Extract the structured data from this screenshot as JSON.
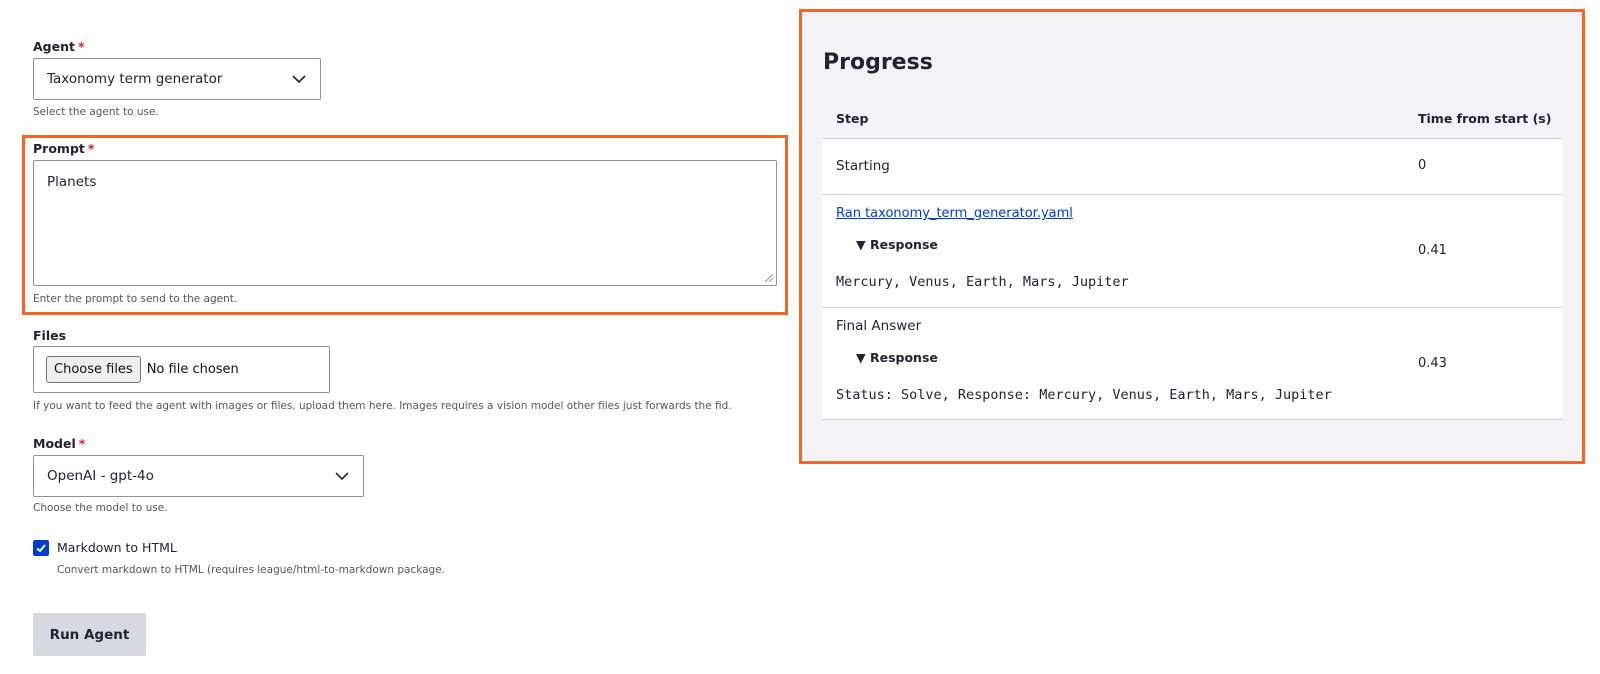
{
  "form": {
    "agent": {
      "label": "Agent",
      "required": "*",
      "value": "Taxonomy term generator",
      "description": "Select the agent to use."
    },
    "prompt": {
      "label": "Prompt",
      "required": "*",
      "value": "Planets",
      "description": "Enter the prompt to send to the agent."
    },
    "files": {
      "label": "Files",
      "button": "Choose files",
      "status": "No file chosen",
      "description": "If you want to feed the agent with images or files, upload them here. Images requires a vision model other files just forwards the fid."
    },
    "model": {
      "label": "Model",
      "required": "*",
      "value": "OpenAI - gpt-4o",
      "description": "Choose the model to use."
    },
    "markdown": {
      "label": "Markdown to HTML",
      "checked": true,
      "description": "Convert markdown to HTML (requires league/html-to-markdown package."
    },
    "run_button": "Run Agent"
  },
  "progress": {
    "title": "Progress",
    "columns": [
      "Step",
      "Time from start (s)"
    ],
    "rows": [
      {
        "step": "Starting",
        "time": "0"
      },
      {
        "step": "Ran taxonomy_term_generator.yaml",
        "details": "▼ Response",
        "output": "Mercury, Venus, Earth, Mars, Jupiter",
        "time": "0.41"
      },
      {
        "step": "Final Answer",
        "details": "▼ Response",
        "output": "Status: Solve, Response: Mercury, Venus, Earth, Mars, Jupiter",
        "time": "0.43"
      }
    ]
  },
  "colors": {
    "highlight": "#f26522",
    "link": "#003ecc",
    "required": "#dc2323",
    "panel_bg": "#f3f2f6",
    "checkbox": "#003ecc"
  }
}
